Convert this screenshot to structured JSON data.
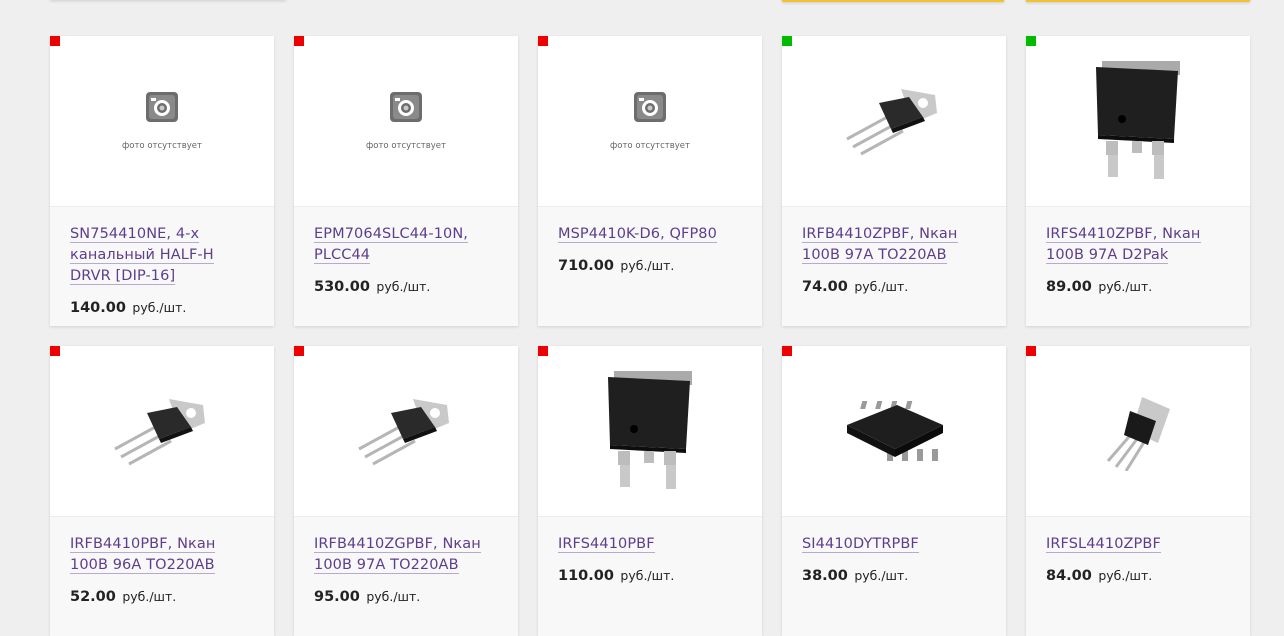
{
  "colors": {
    "in_stock": "#00bb00",
    "out_of_stock": "#ee0000",
    "link": "#5e3d8c",
    "accent_yellow": "#f1c232"
  },
  "no_photo_text": "фото отсутствует",
  "products": [
    {
      "name": "SN754410NE, 4-х канальный HALF-H DRVR [DIP-16]",
      "price": "140.00",
      "unit": "руб./шт.",
      "stock": "out",
      "image": "no-photo-icon"
    },
    {
      "name": "EPM7064SLC44-10N, PLCC44",
      "price": "530.00",
      "unit": "руб./шт.",
      "stock": "out",
      "image": "no-photo-icon"
    },
    {
      "name": "MSP4410K-D6, QFP80",
      "price": "710.00",
      "unit": "руб./шт.",
      "stock": "out",
      "image": "no-photo-icon"
    },
    {
      "name": "IRFB4410ZPBF, Nкан 100В 97А TO220AB",
      "price": "74.00",
      "unit": "руб./шт.",
      "stock": "in",
      "image": "to220-transistor-icon"
    },
    {
      "name": "IRFS4410ZPBF, Nкан 100В 97А D2Pak",
      "price": "89.00",
      "unit": "руб./шт.",
      "stock": "in",
      "image": "d2pak-transistor-icon"
    },
    {
      "name": "IRFB4410PBF, Nкан 100В 96А TO220AB",
      "price": "52.00",
      "unit": "руб./шт.",
      "stock": "out",
      "image": "to220-transistor-icon"
    },
    {
      "name": "IRFB4410ZGPBF, Nкан 100В 97А TO220AB",
      "price": "95.00",
      "unit": "руб./шт.",
      "stock": "out",
      "image": "to220-transistor-icon"
    },
    {
      "name": "IRFS4410PBF",
      "price": "110.00",
      "unit": "руб./шт.",
      "stock": "out",
      "image": "d2pak-transistor-icon"
    },
    {
      "name": "SI4410DYTRPBF",
      "price": "38.00",
      "unit": "руб./шт.",
      "stock": "out",
      "image": "soic8-chip-icon"
    },
    {
      "name": "IRFSL4410ZPBF",
      "price": "84.00",
      "unit": "руб./шт.",
      "stock": "out",
      "image": "to262-transistor-icon"
    }
  ]
}
